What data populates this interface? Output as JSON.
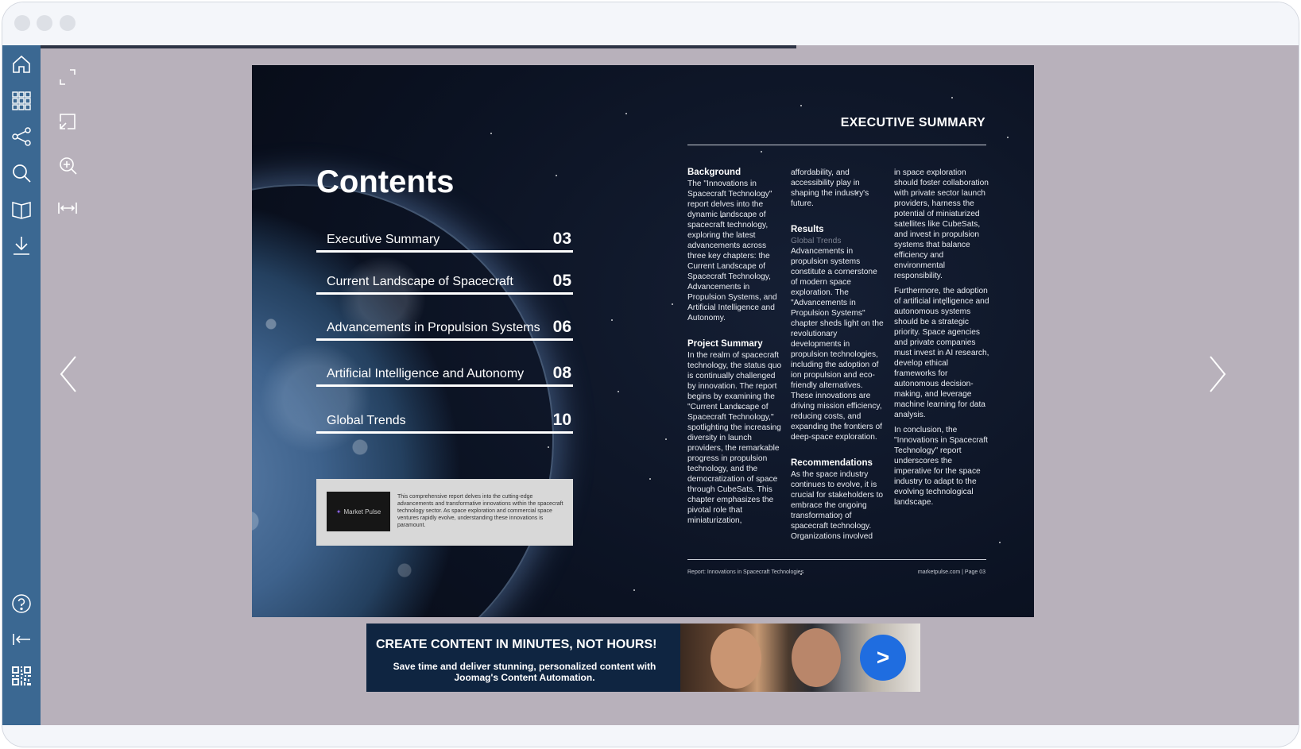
{
  "sidebar": {
    "items": [
      {
        "name": "home",
        "icon": "home-icon"
      },
      {
        "name": "thumbnails",
        "icon": "grid-icon"
      },
      {
        "name": "share",
        "icon": "share-icon"
      },
      {
        "name": "search",
        "icon": "search-icon"
      },
      {
        "name": "table-of-contents",
        "icon": "book-icon"
      },
      {
        "name": "download",
        "icon": "download-icon"
      },
      {
        "name": "help",
        "icon": "help-icon"
      },
      {
        "name": "first-page",
        "icon": "first-page-icon"
      },
      {
        "name": "qr-code",
        "icon": "qr-code-icon"
      }
    ]
  },
  "toolbar": {
    "items": [
      {
        "name": "fullscreen",
        "icon": "expand-icon"
      },
      {
        "name": "cast",
        "icon": "cast-icon"
      },
      {
        "name": "zoom-in",
        "icon": "zoom-in-icon"
      },
      {
        "name": "fit-width",
        "icon": "fit-width-icon"
      }
    ]
  },
  "reading_progress": 0.6,
  "contents": {
    "title": "Contents",
    "items": [
      {
        "label": "Executive Summary",
        "page": "03"
      },
      {
        "label": "Current Landscape of Spacecraft",
        "page": "05"
      },
      {
        "label": "Advancements in Propulsion Systems",
        "page": "06"
      },
      {
        "label": "Artificial Intelligence and Autonomy",
        "page": "08"
      },
      {
        "label": "Global Trends",
        "page": "10"
      }
    ],
    "promo": {
      "logo": "Market Pulse",
      "text": "This comprehensive report delves into the cutting-edge advancements and transformative innovations within the spacecraft technology sector. As space exploration and commercial space ventures rapidly evolve, understanding these innovations is paramount."
    }
  },
  "summary": {
    "title": "EXECUTIVE  SUMMARY",
    "col1": {
      "h_background": "Background",
      "p_background": "The \"Innovations in Spacecraft Technology\" report delves into the dynamic landscape of spacecraft technology, exploring the latest advancements across three key chapters: the Current Landscape of Spacecraft Technology, Advancements in Propulsion Systems, and Artificial Intelligence and Autonomy.",
      "h_project": "Project Summary",
      "p_project": "In the realm of spacecraft technology, the status quo is continually challenged by innovation. The report begins by examining the \"Current Landscape of Spacecraft Technology,\" spotlighting the increasing diversity in launch providers, the remarkable progress in propulsion technology, and the democratization of space through CubeSats. This chapter emphasizes the pivotal role that miniaturization,"
    },
    "col2": {
      "p_cont": "affordability, and accessibility play in shaping the industry's future.",
      "h_results": "Results",
      "sub_results": "Global Trends",
      "p_results": "Advancements in propulsion systems constitute a cornerstone of modern space exploration. The \"Advancements in Propulsion Systems\" chapter sheds light on the revolutionary developments in propulsion technologies, including the adoption of ion propulsion and eco-friendly alternatives. These innovations are driving mission efficiency, reducing costs, and expanding the frontiers of deep-space exploration.",
      "h_recommend": "Recommendations",
      "p_recommend": "As the space industry continues to evolve, it is crucial for stakeholders to embrace the ongoing transformation of spacecraft technology. Organizations involved"
    },
    "col3": {
      "p1": "in space exploration should foster collaboration with private sector launch providers, harness the potential of miniaturized satellites like CubeSats, and invest in propulsion systems that balance efficiency and environmental responsibility.",
      "p2": "Furthermore, the adoption of artificial intelligence and autonomous systems should be a strategic priority. Space agencies and private companies must invest in AI research, develop ethical frameworks for autonomous decision-making, and leverage machine learning for data analysis.",
      "p3": "In conclusion, the \"Innovations in Spacecraft Technology\" report underscores the imperative for the space industry to adapt to the evolving technological landscape."
    },
    "footer_left": "Report: Innovations in Spacecraft Technologies",
    "footer_right": "marketpulse.com  |  Page 03"
  },
  "ad": {
    "headline": "CREATE CONTENT IN MINUTES, NOT HOURS!",
    "sub": "Save time and deliver stunning, personalized content with Joomag's Content Automation.",
    "button_label": ">"
  },
  "colors": {
    "sidebar": "#3b6892",
    "stage": "#b8b1bb",
    "ad_bg": "#0f2541",
    "ad_button": "#1f6de0"
  }
}
